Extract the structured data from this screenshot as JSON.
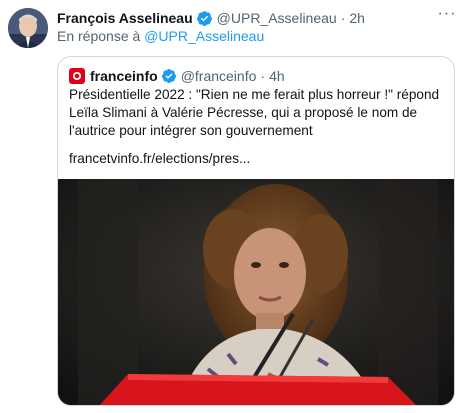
{
  "tweet": {
    "author_name": "François Asselineau",
    "author_handle": "@UPR_Asselineau",
    "separator": "·",
    "time": "2h",
    "reply_prefix": "En réponse à",
    "reply_to": "@UPR_Asselineau",
    "more_label": "···"
  },
  "quoted": {
    "author_name": "franceinfo",
    "author_handle": "@franceinfo",
    "separator": "·",
    "time": "4h",
    "text": "Présidentielle 2022 : \"Rien ne me ferait plus horreur !\" répond Leïla Slimani à Valérie Pécresse, qui a proposé le nom de l'autrice pour intégrer son gouvernement",
    "link": "francetvinfo.fr/elections/pres..."
  },
  "colors": {
    "accent": "#1d9bf0",
    "secondary_text": "#536471",
    "border": "#cfd9de",
    "franceinfo_brand": "#e1001a"
  }
}
